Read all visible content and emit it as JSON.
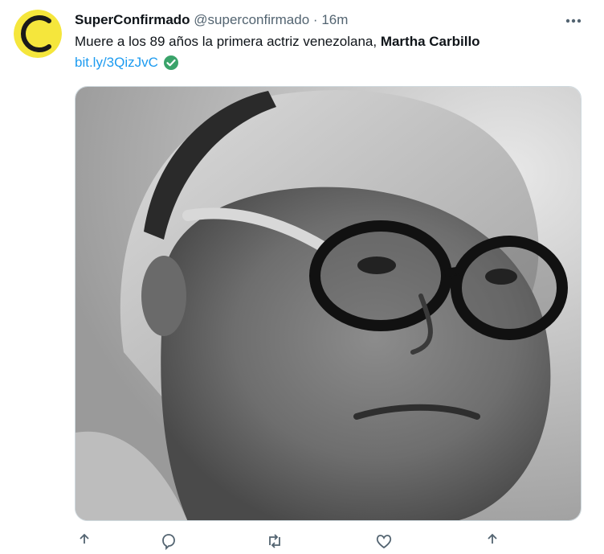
{
  "tweet": {
    "display_name": "SuperConfirmado",
    "handle": "@superconfirmado",
    "separator": "·",
    "time": "16m",
    "text_prefix": "Muere a los 89 años la primera actriz venezolana, ",
    "text_bold": "Martha Carbillo",
    "link": "bit.ly/3QizJvC",
    "avatar_icon": "yellow-c-logo",
    "verified_icon": "green-check-circle",
    "image_description": "black-and-white portrait photo",
    "actions": [
      "share-up-icon",
      "reply-icon",
      "retweet-icon",
      "like-icon",
      "share-icon"
    ]
  },
  "colors": {
    "link": "#1d9bf0",
    "secondary_text": "#536471",
    "avatar_yellow": "#f5e63c",
    "check_green": "#3aa36a"
  }
}
